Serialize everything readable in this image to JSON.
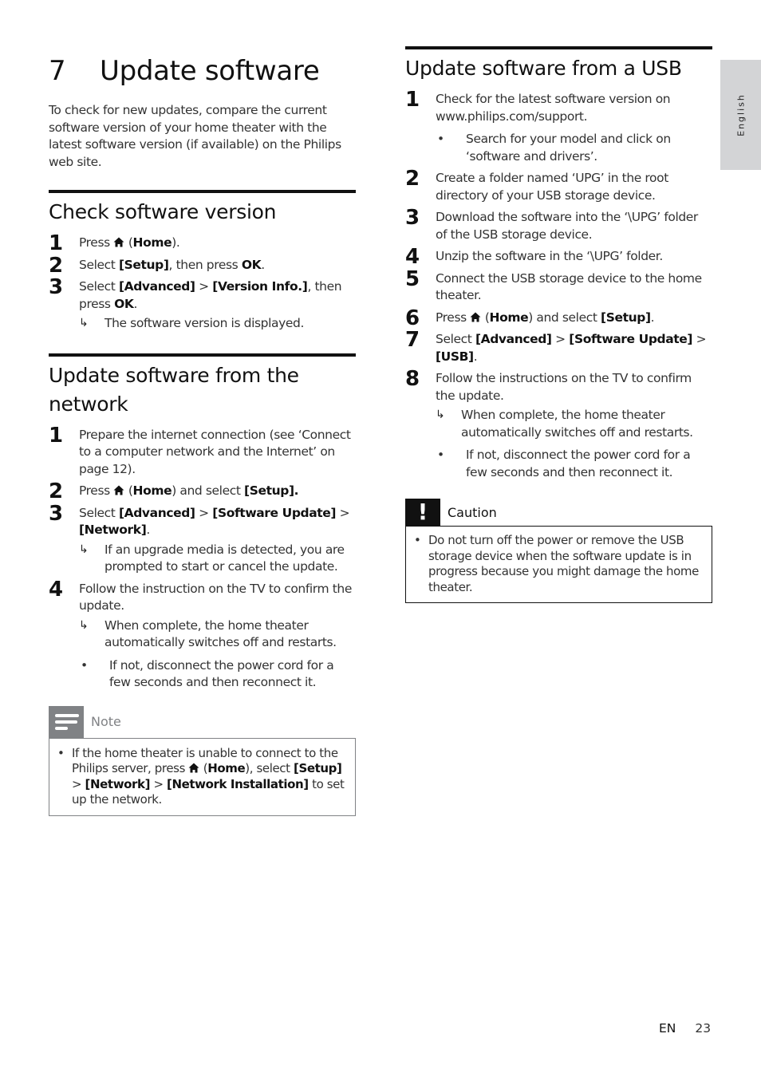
{
  "chapter": {
    "number": "7",
    "title": "Update software",
    "intro": "To check for new updates, compare the current software version of your home theater with the latest software version (if available) on the Philips web site."
  },
  "check_section": {
    "title": "Check software version",
    "steps": [
      {
        "num": "1",
        "parts": [
          "Press ",
          {
            "icon": "home-icon"
          },
          " (",
          {
            "b": "Home"
          },
          ")."
        ]
      },
      {
        "num": "2",
        "parts": [
          "Select ",
          {
            "b": "[Setup]"
          },
          ", then press ",
          {
            "b": "OK"
          },
          "."
        ]
      },
      {
        "num": "3",
        "parts": [
          "Select ",
          {
            "b": "[Advanced]"
          },
          " > ",
          {
            "b": "[Version Info.]"
          },
          ", then press ",
          {
            "b": "OK"
          },
          "."
        ],
        "result": "The software version is displayed."
      }
    ]
  },
  "network_section": {
    "title": "Update software from the network",
    "steps": [
      {
        "num": "1",
        "parts": [
          "Prepare the internet connection (see ‘Connect to a computer network and the Internet’ on page 12)."
        ]
      },
      {
        "num": "2",
        "parts": [
          "Press ",
          {
            "icon": "home-icon"
          },
          " (",
          {
            "b": "Home"
          },
          ") and select ",
          {
            "b": "[Setup]."
          }
        ]
      },
      {
        "num": "3",
        "parts": [
          "Select ",
          {
            "b": "[Advanced]"
          },
          " > ",
          {
            "b": "[Software Update]"
          },
          " > ",
          {
            "b": "[Network]"
          },
          "."
        ],
        "result": "If an upgrade media is detected, you are prompted to start or cancel the update."
      },
      {
        "num": "4",
        "parts": [
          "Follow the instruction on the TV to confirm the update."
        ],
        "result": "When complete, the home theater automatically switches off and restarts.",
        "bullet": "If not, disconnect the power cord for a few seconds and then reconnect it."
      }
    ],
    "note": {
      "label": "Note",
      "parts": [
        "If the home theater is unable to connect to the Philips server, press ",
        {
          "icon": "home-icon"
        },
        " (",
        {
          "b": "Home"
        },
        "), select ",
        {
          "b": "[Setup]"
        },
        " > ",
        {
          "b": "[Network]"
        },
        " > ",
        {
          "b": "[Network Installation]"
        },
        " to set up the network."
      ]
    }
  },
  "usb_section": {
    "title": "Update software from a USB",
    "steps": [
      {
        "num": "1",
        "parts": [
          "Check for the latest software version on www.philips.com/support."
        ],
        "bullet": "Search for your model and click on ‘software and drivers’."
      },
      {
        "num": "2",
        "parts": [
          "Create a folder named ‘UPG’ in the root directory of your USB storage device."
        ]
      },
      {
        "num": "3",
        "parts": [
          "Download the software into the ‘\\UPG’ folder of the USB storage device."
        ]
      },
      {
        "num": "4",
        "parts": [
          "Unzip the software in the ‘\\UPG’ folder."
        ]
      },
      {
        "num": "5",
        "parts": [
          "Connect the USB storage device to the home theater."
        ]
      },
      {
        "num": "6",
        "parts": [
          "Press ",
          {
            "icon": "home-icon"
          },
          " (",
          {
            "b": "Home"
          },
          ") and select ",
          {
            "b": "[Setup]"
          },
          "."
        ]
      },
      {
        "num": "7",
        "parts": [
          "Select ",
          {
            "b": "[Advanced]"
          },
          " > ",
          {
            "b": "[Software Update]"
          },
          " > ",
          {
            "b": "[USB]"
          },
          "."
        ]
      },
      {
        "num": "8",
        "parts": [
          "Follow the instructions on the TV to confirm the update."
        ],
        "result": "When complete, the home theater automatically switches off and restarts.",
        "bullet": "If not, disconnect the power cord for a few seconds and then reconnect it."
      }
    ],
    "caution": {
      "label": "Caution",
      "icon": "!",
      "text": "Do not turn off the power or remove the USB storage device when the software update is in progress because you might damage the home theater."
    }
  },
  "side_tab": {
    "label": "English"
  },
  "footer": {
    "lang": "EN",
    "page": "23"
  },
  "glyphs": {
    "result_arrow": "↳",
    "bullet": "•"
  }
}
